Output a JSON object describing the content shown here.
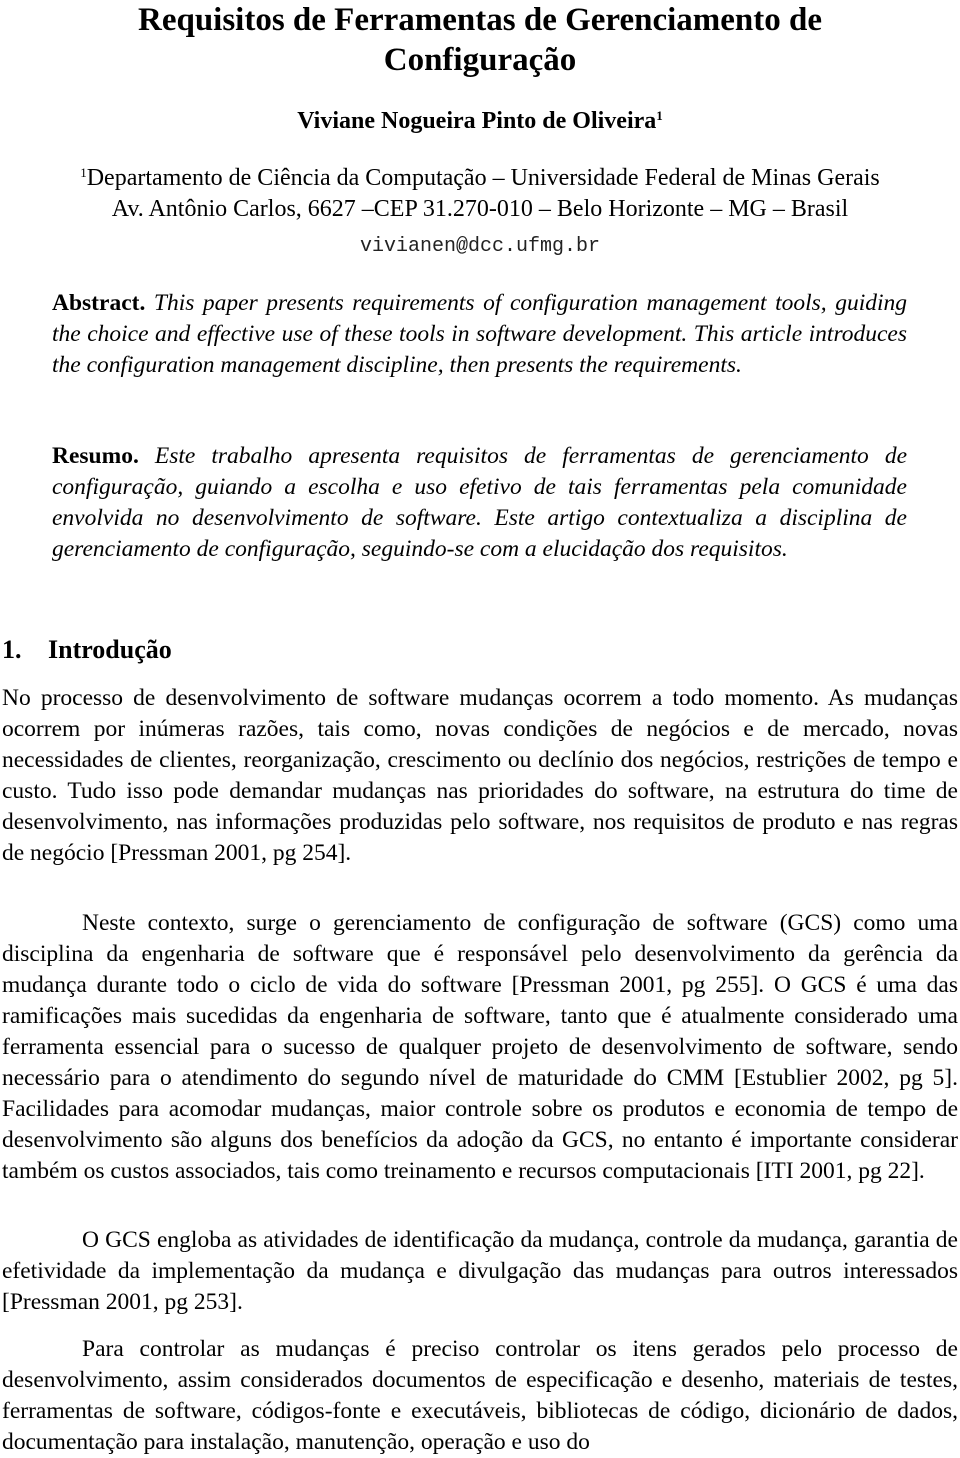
{
  "paper": {
    "title_line1": "Requisitos de Ferramentas de Gerenciamento de",
    "title_line2": "Configuração",
    "author": "Viviane Nogueira Pinto de Oliveira",
    "author_sup": "1",
    "affiliation_sup": "1",
    "affiliation_line1": "Departamento de Ciência da Computação – Universidade Federal de Minas Gerais",
    "affiliation_line2": "Av. Antônio Carlos, 6627 –CEP 31.270-010 – Belo Horizonte – MG – Brasil",
    "email": "vivianen@dcc.ufmg.br"
  },
  "abstract_en": {
    "label": "Abstract.",
    "text": "This paper presents requirements of configuration management tools, guiding the choice and effective use of these tools in software development. This article introduces the configuration management discipline, then presents the requirements."
  },
  "abstract_pt": {
    "label": "Resumo.",
    "text": "Este trabalho apresenta requisitos de ferramentas de gerenciamento de configuração, guiando a escolha e uso efetivo de tais ferramentas pela comunidade envolvida no desenvolvimento de software. Este artigo contextualiza a disciplina de gerenciamento de configuração, seguindo-se com a elucidação dos requisitos."
  },
  "section1": {
    "number": "1.",
    "title": "Introdução",
    "paragraphs": [
      "No processo de desenvolvimento de software mudanças ocorrem a todo momento. As mudanças ocorrem por inúmeras razões, tais como, novas condições de negócios e de mercado, novas necessidades de clientes, reorganização, crescimento ou declínio dos negócios, restrições de tempo e custo. Tudo isso pode demandar mudanças nas prioridades do software, na estrutura do time de desenvolvimento, nas informações produzidas pelo software, nos requisitos de produto e nas regras de negócio [Pressman 2001, pg 254].",
      "Neste contexto, surge o gerenciamento de configuração de software (GCS) como uma disciplina da engenharia de software que é responsável pelo desenvolvimento da gerência da mudança durante todo o ciclo de vida do software [Pressman 2001, pg 255]. O GCS é uma das ramificações mais sucedidas da engenharia de software, tanto que é atualmente considerado uma ferramenta essencial para o sucesso de qualquer projeto de desenvolvimento de software, sendo necessário para o atendimento do segundo nível de maturidade do CMM [Estublier 2002, pg 5]. Facilidades para acomodar mudanças, maior controle sobre os produtos e economia de tempo de desenvolvimento são alguns dos benefícios da adoção da GCS, no entanto é importante considerar também os custos associados, tais como treinamento e recursos computacionais [ITI 2001, pg 22].",
      "O GCS engloba as atividades de identificação da mudança, controle da mudança, garantia de efetividade da implementação da mudança e divulgação das mudanças para outros interessados [Pressman 2001, pg 253].",
      "Para controlar as mudanças é preciso controlar os itens gerados pelo processo de desenvolvimento, assim considerados documentos de especificação e desenho, materiais de testes, ferramentas de software, códigos-fonte e executáveis, bibliotecas de código, dicionário de dados, documentação para instalação, manutenção, operação e uso do"
    ]
  }
}
